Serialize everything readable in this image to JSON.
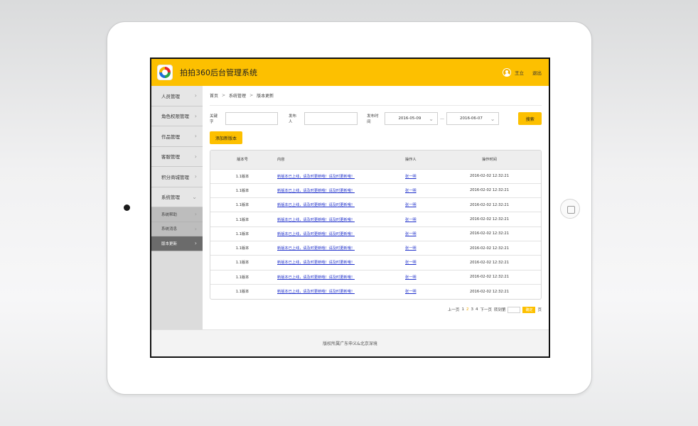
{
  "header": {
    "title": "拍拍360后台管理系统",
    "username": "王立",
    "logout": "退出"
  },
  "sidebar": {
    "items": [
      {
        "label": "人员管理"
      },
      {
        "label": "角色权限管理"
      },
      {
        "label": "作品管理"
      },
      {
        "label": "客服管理"
      },
      {
        "label": "积分商城管理"
      },
      {
        "label": "系统管理"
      }
    ],
    "subitems": [
      {
        "label": "系统帮助"
      },
      {
        "label": "系统消息"
      },
      {
        "label": "版本更新"
      }
    ]
  },
  "breadcrumb": {
    "home": "首页",
    "level1": "系统管理",
    "level2": "版本更新",
    "sep": ">"
  },
  "filters": {
    "keyword_label": "关键字",
    "keyword_value": "",
    "publisher_label": "发布人",
    "publisher_value": "",
    "date_label": "发布时间",
    "date_from": "2016-05-09",
    "date_to": "2016-06-07",
    "range_sep": "—",
    "search_button": "搜索"
  },
  "add_button": "添加新版本",
  "table": {
    "headers": [
      "版本号",
      "内容",
      "操作人",
      "操作时间"
    ],
    "rows": [
      {
        "version": "1.1版本",
        "content": "新版本已上线，请及时更新哦！请及时更新哦！",
        "operator": "张一明",
        "time": "2016-02-02  12:32:21"
      },
      {
        "version": "1.1版本",
        "content": "新版本已上线，请及时更新哦！请及时更新哦！",
        "operator": "张一明",
        "time": "2016-02-02  12:32:21"
      },
      {
        "version": "1.1版本",
        "content": "新版本已上线，请及时更新哦！请及时更新哦！",
        "operator": "张一明",
        "time": "2016-02-02  12:32:21"
      },
      {
        "version": "1.1版本",
        "content": "新版本已上线，请及时更新哦！请及时更新哦！",
        "operator": "张一明",
        "time": "2016-02-02  12:32:21"
      },
      {
        "version": "1.1版本",
        "content": "新版本已上线，请及时更新哦！请及时更新哦！",
        "operator": "张一明",
        "time": "2016-02-02  12:32:21"
      },
      {
        "version": "1.1版本",
        "content": "新版本已上线，请及时更新哦！请及时更新哦！",
        "operator": "张一明",
        "time": "2016-02-02  12:32:21"
      },
      {
        "version": "1.1版本",
        "content": "新版本已上线，请及时更新哦！请及时更新哦！",
        "operator": "张一明",
        "time": "2016-02-02  12:32:21"
      },
      {
        "version": "1.1版本",
        "content": "新版本已上线，请及时更新哦！请及时更新哦！",
        "operator": "张一明",
        "time": "2016-02-02  12:32:21"
      },
      {
        "version": "1.1版本",
        "content": "新版本已上线，请及时更新哦！请及时更新哦！",
        "operator": "张一明",
        "time": "2016-02-02  12:32:21"
      }
    ]
  },
  "pagination": {
    "prev": "上一页",
    "pages": [
      "1",
      "2",
      "3",
      "4"
    ],
    "current_page": "2",
    "next": "下一页",
    "goto_label": "转到第",
    "confirm": "确定",
    "page_suffix": "页"
  },
  "footer": "版权所属广东申义&北京深境",
  "colors": {
    "accent": "#fdc000",
    "sidebar_active": "#6b6b6b",
    "link": "#2233cc"
  }
}
